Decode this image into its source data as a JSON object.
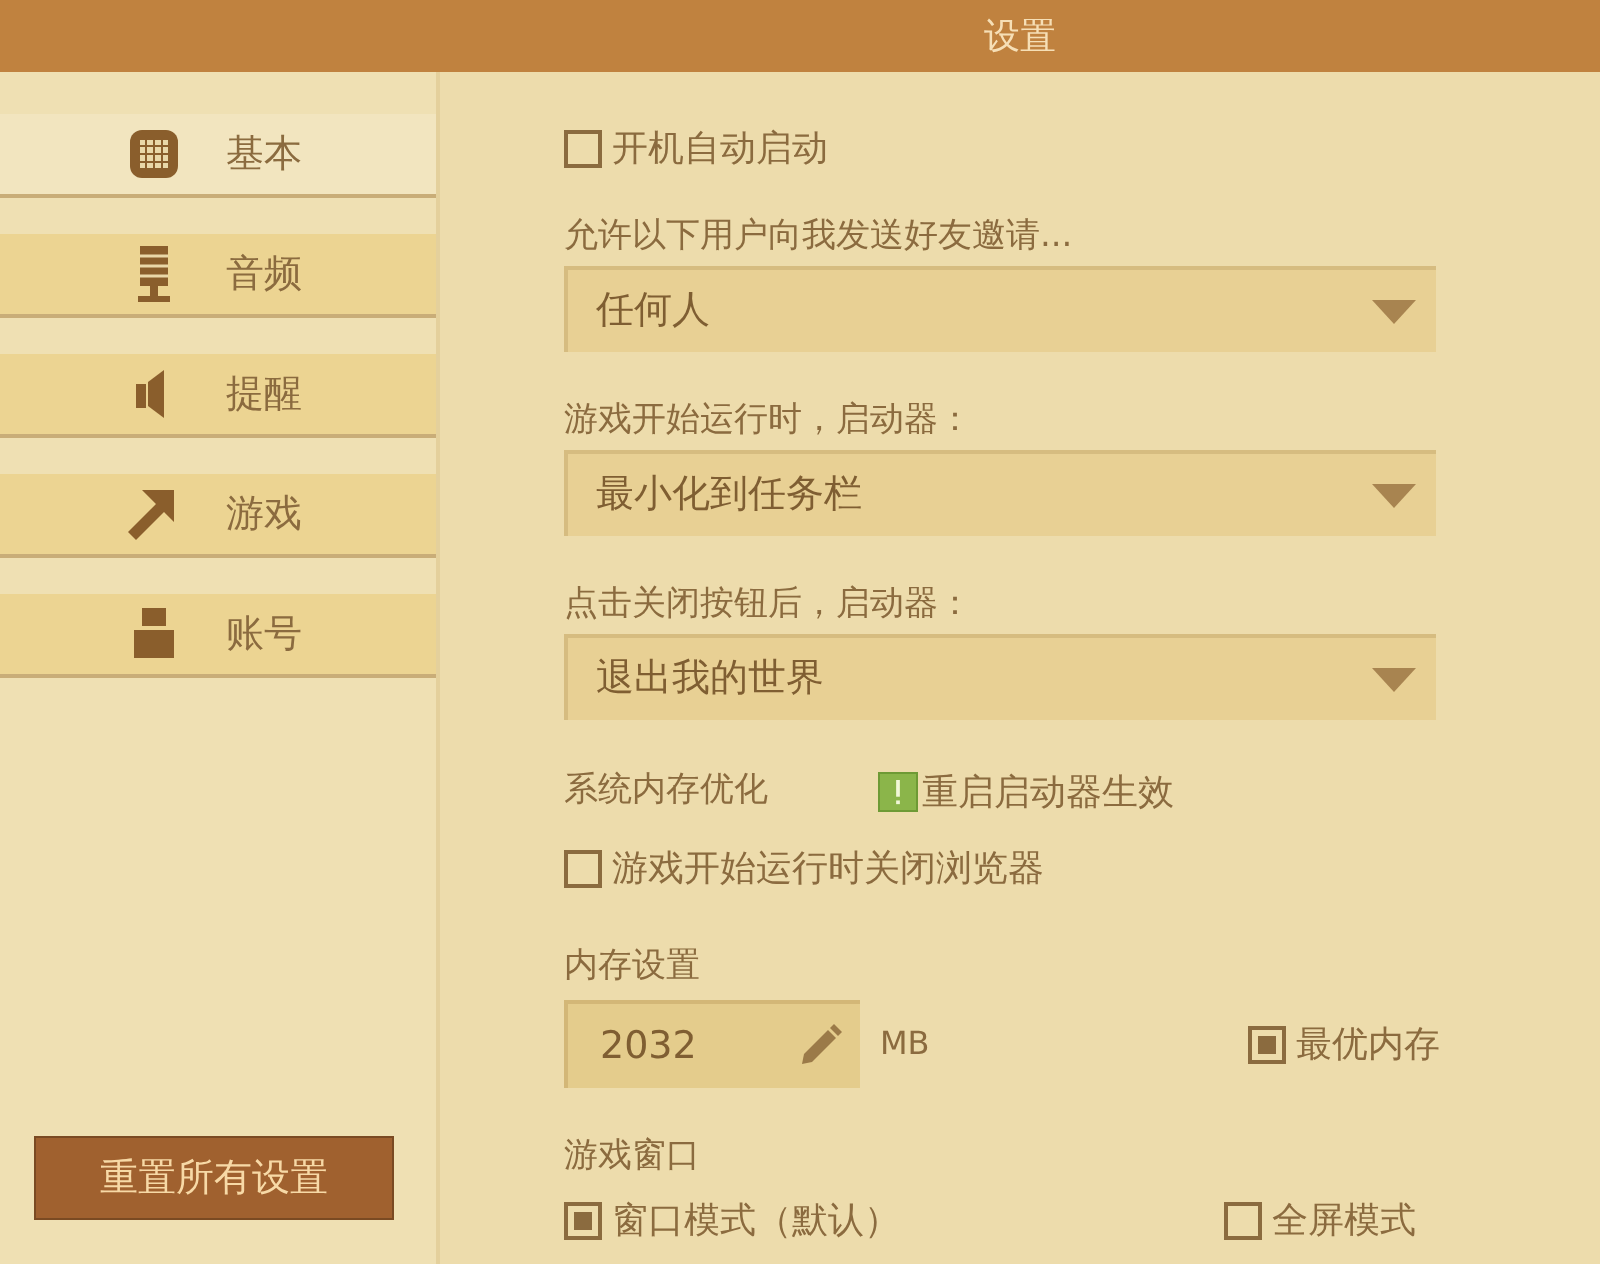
{
  "window": {
    "title": "设置"
  },
  "sidebar": {
    "items": [
      {
        "label": "基本",
        "selected": true
      },
      {
        "label": "音频",
        "selected": false
      },
      {
        "label": "提醒",
        "selected": false
      },
      {
        "label": "游戏",
        "selected": false
      },
      {
        "label": "账号",
        "selected": false
      }
    ],
    "reset_button": "重置所有设置"
  },
  "autostart": {
    "label": "开机自动启动",
    "checked": false
  },
  "dropdowns": [
    {
      "label": "允许以下用户向我发送好友邀请...",
      "value": "任何人"
    },
    {
      "label": "游戏开始运行时，启动器：",
      "value": "最小化到任务栏"
    },
    {
      "label": "点击关闭按钮后，启动器：",
      "value": "退出我的世界"
    }
  ],
  "memory_optimization": {
    "label": "系统内存优化",
    "notice": "重启启动器生效"
  },
  "close_browser": {
    "label": "游戏开始运行时关闭浏览器",
    "checked": false
  },
  "memory": {
    "label": "内存设置",
    "value": "2032",
    "unit": "MB",
    "optimal": {
      "label": "最优内存",
      "checked": true
    }
  },
  "game_window": {
    "label": "游戏窗口",
    "options": [
      {
        "label": "窗口模式（默认）",
        "selected": true
      },
      {
        "label": "全屏模式",
        "selected": false
      }
    ]
  }
}
